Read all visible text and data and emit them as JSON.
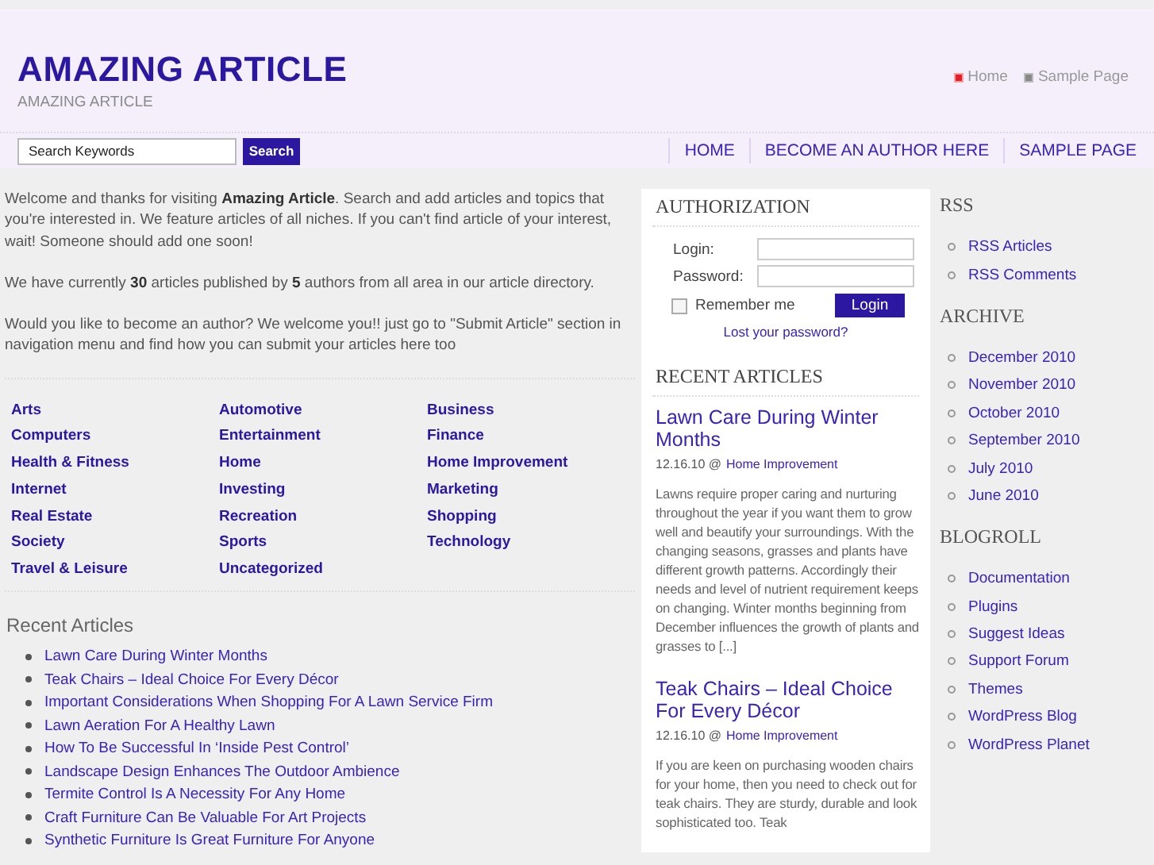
{
  "header": {
    "title": "AMAZING ARTICLE",
    "tagline": "AMAZING ARTICLE",
    "top_links": [
      {
        "label": "Home",
        "selected": true
      },
      {
        "label": "Sample Page",
        "selected": false
      }
    ]
  },
  "search": {
    "placeholder": "Search Keywords",
    "button": "Search"
  },
  "nav": [
    "HOME",
    "BECOME AN AUTHOR HERE",
    "SAMPLE PAGE"
  ],
  "intro": [
    "Welcome and thanks for visiting **Amazing Article**. Search and add articles and topics that you're interested in. We feature articles of all niches. If you can't find article of your interest, wait! Someone should add one soon!",
    "We have currently **30** articles published by **5** authors from all area in our article directory.",
    "Would you like to become an author? We welcome you!! just go to \"Submit Article\" section in navigation menu and find how you can submit your articles here too"
  ],
  "categories": [
    [
      "Arts",
      "Computers",
      "Health & Fitness",
      "Internet",
      "Real Estate",
      "Society",
      "Travel & Leisure"
    ],
    [
      "Automotive",
      "Entertainment",
      "Home",
      "Investing",
      "Recreation",
      "Sports",
      "Uncategorized"
    ],
    [
      "Business",
      "Finance",
      "Home Improvement",
      "Marketing",
      "Shopping",
      "Technology"
    ]
  ],
  "recent_articles": {
    "title": "Recent Articles",
    "items": [
      "Lawn Care During Winter Months",
      "Teak Chairs – Ideal Choice For Every Décor",
      "Important Considerations When Shopping For A Lawn Service Firm",
      "Lawn Aeration For A Healthy Lawn",
      "How To Be Successful In ‘Inside Pest Control’",
      "Landscape Design Enhances The Outdoor Ambience",
      "Termite Control Is A Necessity For Any Home",
      "Craft Furniture Can Be Valuable For Art Projects",
      "Synthetic Furniture Is Great Furniture For Anyone"
    ]
  },
  "authorization": {
    "title": "AUTHORIZATION",
    "login_label": "Login:",
    "password_label": "Password:",
    "remember": {
      "label": "Remember me",
      "checked": false
    },
    "button": "Login",
    "lost_password": "Lost your password?"
  },
  "recent_posts": {
    "title": "RECENT ARTICLES",
    "posts": [
      {
        "title": "Lawn Care During Winter Months",
        "date": "12.16.10 @",
        "category": "Home Improvement",
        "excerpt": "Lawns require proper caring and nurturing throughout the year if you want them to grow well and beautify your surroundings. With the changing seasons, grasses and plants have different growth patterns. Accordingly their needs and level of nutrient requirement keeps on changing. Winter months beginning from December influences the growth of plants and grasses to [...]"
      },
      {
        "title": "Teak Chairs – Ideal Choice For Every Décor",
        "date": "12.16.10 @",
        "category": "Home Improvement",
        "excerpt": "If you are keen on purchasing wooden chairs for your home, then you need to check out for teak chairs. They are sturdy, durable and look sophisticated too. Teak"
      }
    ]
  },
  "sidebar": [
    {
      "title": "RSS",
      "items": [
        "RSS Articles",
        "RSS Comments"
      ]
    },
    {
      "title": "ARCHIVE",
      "items": [
        "December 2010",
        "November 2010",
        "October 2010",
        "September 2010",
        "July 2010",
        "June 2010"
      ]
    },
    {
      "title": "BLOGROLL",
      "items": [
        "Documentation",
        "Plugins",
        "Suggest Ideas",
        "Support Forum",
        "Themes",
        "WordPress Blog",
        "WordPress Planet"
      ]
    }
  ]
}
